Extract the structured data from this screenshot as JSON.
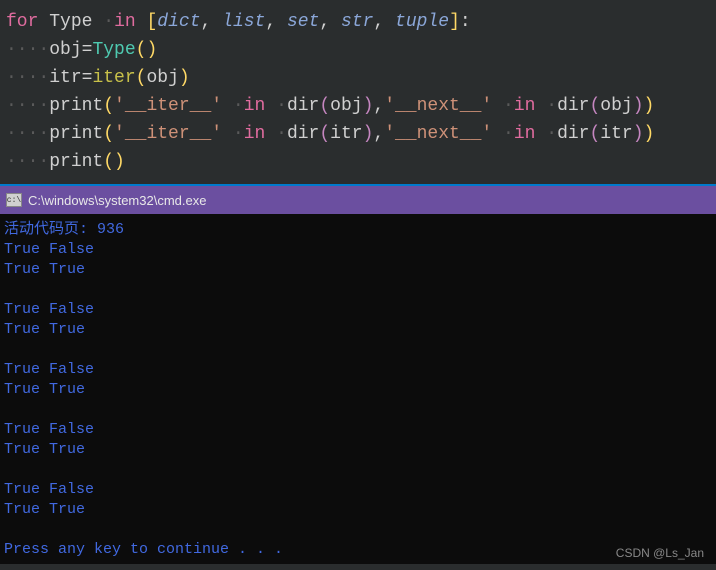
{
  "code": {
    "line1": {
      "for": "for",
      "var": "Type",
      "in": "in",
      "types": [
        "dict",
        "list",
        "set",
        "str",
        "tuple"
      ]
    },
    "line2": {
      "dots": "····",
      "lhs": "obj",
      "eq": "=",
      "rhs_fn": "Type",
      "args": ""
    },
    "line3": {
      "dots": "····",
      "lhs": "itr",
      "eq": "=",
      "rhs_fn": "iter",
      "args": "obj"
    },
    "line4": {
      "dots": "····",
      "fn": "print",
      "s1": "'__iter__'",
      "in": "in",
      "d": "dir",
      "a1": "obj",
      "s2": "'__next__'",
      "a2": "obj"
    },
    "line5": {
      "dots": "····",
      "fn": "print",
      "s1": "'__iter__'",
      "in": "in",
      "d": "dir",
      "a1": "itr",
      "s2": "'__next__'",
      "a2": "itr"
    },
    "line6": {
      "dots": "····",
      "fn": "print"
    }
  },
  "terminal": {
    "title": "C:\\windows\\system32\\cmd.exe",
    "lines": [
      "活动代码页: 936",
      "True False",
      "True True",
      "",
      "True False",
      "True True",
      "",
      "True False",
      "True True",
      "",
      "True False",
      "True True",
      "",
      "True False",
      "True True",
      "",
      "Press any key to continue . . ."
    ]
  },
  "watermark": "CSDN @Ls_Jan"
}
